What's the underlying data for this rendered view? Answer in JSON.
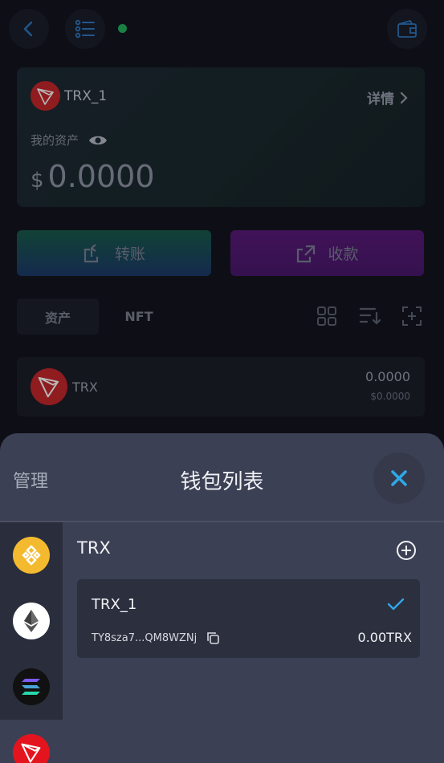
{
  "header": {
    "back_icon": "chevron-left-icon",
    "list_icon": "list-icon",
    "wallet_icon": "wallet-icon",
    "status_color": "#22b35e"
  },
  "wallet_card": {
    "name": "TRX_1",
    "details_label": "详情",
    "assets_label": "我的资产",
    "currency_symbol": "$",
    "balance": "0.0000"
  },
  "actions": {
    "send_label": "转账",
    "receive_label": "收款"
  },
  "tabs": [
    {
      "label": "资产",
      "active": true
    },
    {
      "label": "NFT",
      "active": false
    }
  ],
  "asset_list": [
    {
      "symbol": "TRX",
      "amount": "0.0000",
      "value": "$0.0000"
    }
  ],
  "sheet": {
    "manage_label": "管理",
    "title": "钱包列表",
    "chains": [
      {
        "name": "bnb",
        "icon": "bnb-icon",
        "color": "#f3ba2f"
      },
      {
        "name": "eth",
        "icon": "ethereum-icon",
        "color": "#ffffff"
      },
      {
        "name": "sol",
        "icon": "solana-icon",
        "color": "#111111"
      },
      {
        "name": "trx",
        "icon": "tron-icon",
        "color": "#e4141e",
        "active": true
      }
    ],
    "section_title": "TRX",
    "wallets": [
      {
        "name": "TRX_1",
        "address": "TY8sza7...QM8WZNj",
        "balance": "0.00TRX",
        "selected": true
      }
    ]
  }
}
